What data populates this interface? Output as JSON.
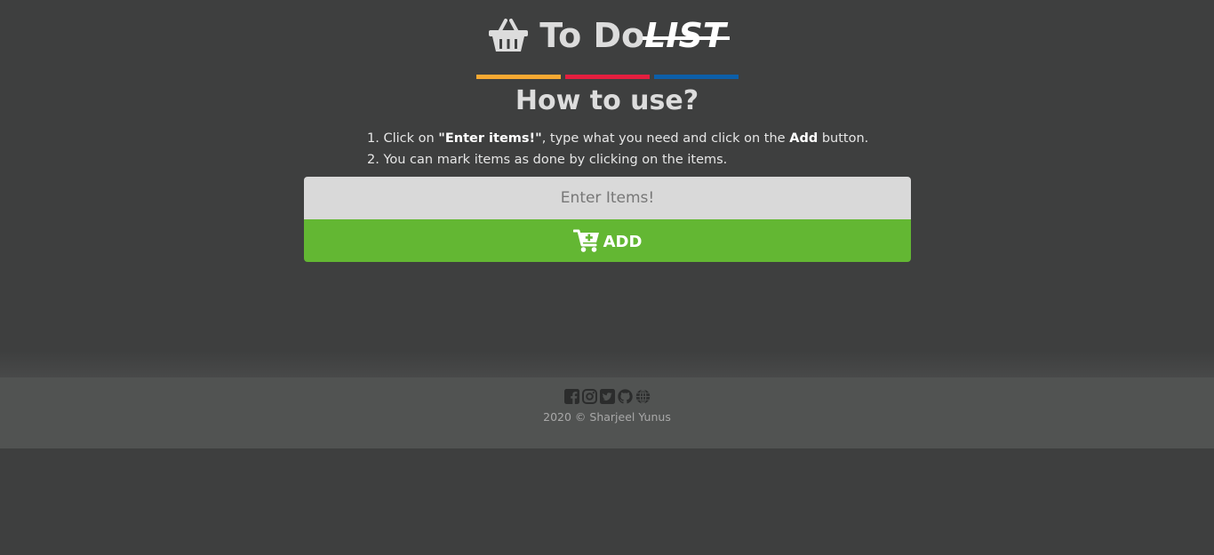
{
  "header": {
    "title_main": "To Do",
    "title_struck": "LIST",
    "icon": "basket-icon",
    "bar_colors": [
      "#f7a932",
      "#e51e3f",
      "#0c5fa9"
    ]
  },
  "help": {
    "heading": "How to use?",
    "step1": {
      "number": "1.",
      "prefix": "Click on",
      "target": "\"Enter items!\"",
      "middle": ", type what you need and click on the",
      "button_name": "Add",
      "suffix": "button."
    },
    "step2": {
      "number": "2.",
      "text": "You can mark items as done by clicking on the items."
    }
  },
  "form": {
    "input_placeholder": "Enter Items!",
    "input_value": "",
    "add_label": "ADD",
    "add_icon": "cart-plus-icon",
    "add_color": "#63b733"
  },
  "footer": {
    "social": [
      "facebook-icon",
      "instagram-icon",
      "twitter-icon",
      "github-icon",
      "globe-icon"
    ],
    "copyright": "2020 © Sharjeel Yunus"
  },
  "colors": {
    "background": "#3e3f3f",
    "footer_background": "#515352",
    "input_background": "#d9d9d9"
  }
}
